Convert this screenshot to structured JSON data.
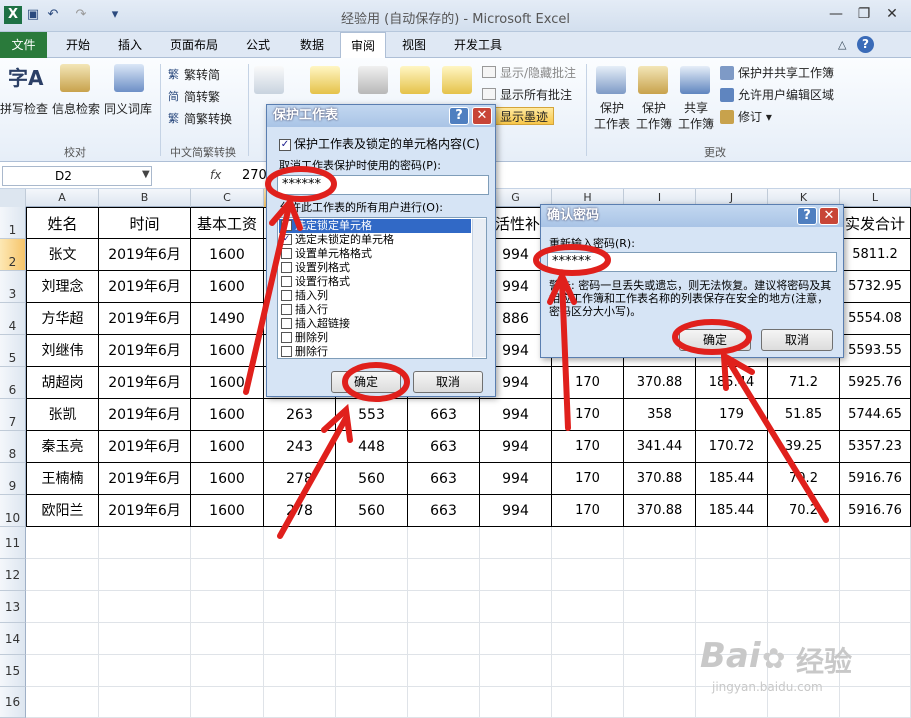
{
  "window": {
    "title": "经验用 (自动保存的)  -  Microsoft Excel",
    "close": "✕",
    "minimize": "—",
    "restore": "❐"
  },
  "ribbon_tabs": [
    "文件",
    "开始",
    "插入",
    "页面布局",
    "公式",
    "数据",
    "审阅",
    "视图",
    "开发工具"
  ],
  "ribbon": {
    "proof": {
      "spell": "拼写检查",
      "research": "信息检索",
      "thesaurus": "同义词库",
      "group": "校对"
    },
    "chinese": {
      "t2s": "繁转简",
      "s2t": "简转繁",
      "convert": "简繁转换",
      "group": "中文简繁转换"
    },
    "comments": {
      "show_hide": "显示/隐藏批注",
      "show_all": "显示所有批注",
      "show_ink": "显示墨迹"
    },
    "changes": {
      "protect_sheet": "保护\n工作表",
      "protect_book": "保护\n工作簿",
      "share_book": "共享\n工作簿",
      "protect_share": "保护并共享工作簿",
      "allow_edit": "允许用户编辑区域",
      "track": "修订 ▾",
      "group": "更改"
    }
  },
  "formula_bar": {
    "name_box": "D2",
    "fx": "fx",
    "value": "270"
  },
  "columns": [
    "A",
    "B",
    "C",
    "D",
    "E",
    "F",
    "G",
    "H",
    "I",
    "J",
    "K",
    "L"
  ],
  "rows": [
    "1",
    "2",
    "3",
    "4",
    "5",
    "6",
    "7",
    "8",
    "9",
    "10",
    "11",
    "12",
    "13",
    "14",
    "15",
    "16"
  ],
  "table": {
    "headers": [
      "姓名",
      "时间",
      "基本工资",
      "",
      "",
      "",
      "生活性补贴",
      "",
      "",
      "",
      "",
      "实发合计"
    ],
    "rows": [
      [
        "张文",
        "2019年6月",
        "1600",
        "",
        "",
        "",
        "994",
        "",
        "",
        "",
        "",
        "5811.2"
      ],
      [
        "刘理念",
        "2019年6月",
        "1600",
        "",
        "",
        "",
        "994",
        "",
        "",
        "",
        "",
        "5732.95"
      ],
      [
        "方华超",
        "2019年6月",
        "1490",
        "",
        "",
        "",
        "886",
        "",
        "",
        "",
        "",
        "5554.08"
      ],
      [
        "刘继伟",
        "2019年6月",
        "1600",
        "",
        "",
        "",
        "994",
        "",
        "",
        "",
        "",
        "5593.55"
      ],
      [
        "胡超岗",
        "2019年6月",
        "1600",
        "",
        "",
        "",
        "994",
        "170",
        "370.88",
        "185.44",
        "71.2",
        "5925.76"
      ],
      [
        "张凯",
        "2019年6月",
        "1600",
        "263",
        "553",
        "663",
        "994",
        "170",
        "358",
        "179",
        "51.85",
        "5744.65"
      ],
      [
        "秦玉亮",
        "2019年6月",
        "1600",
        "243",
        "448",
        "663",
        "994",
        "170",
        "341.44",
        "170.72",
        "39.25",
        "5357.23"
      ],
      [
        "王楠楠",
        "2019年6月",
        "1600",
        "278",
        "560",
        "663",
        "994",
        "170",
        "370.88",
        "185.44",
        "70.2",
        "5916.76"
      ],
      [
        "欧阳兰",
        "2019年6月",
        "1600",
        "278",
        "560",
        "663",
        "994",
        "170",
        "370.88",
        "185.44",
        "70.2",
        "5916.76"
      ]
    ]
  },
  "protect_dialog": {
    "title": "保护工作表",
    "protect_check": "保护工作表及锁定的单元格内容(C)",
    "password_label": "取消工作表保护时使用的密码(P):",
    "password": "******",
    "allow_label": "允许此工作表的所有用户进行(O):",
    "options": [
      {
        "label": "选定锁定单元格",
        "checked": true
      },
      {
        "label": "选定未锁定的单元格",
        "checked": true
      },
      {
        "label": "设置单元格格式",
        "checked": false
      },
      {
        "label": "设置列格式",
        "checked": false
      },
      {
        "label": "设置行格式",
        "checked": false
      },
      {
        "label": "插入列",
        "checked": false
      },
      {
        "label": "插入行",
        "checked": false
      },
      {
        "label": "插入超链接",
        "checked": false
      },
      {
        "label": "删除列",
        "checked": false
      },
      {
        "label": "删除行",
        "checked": false
      }
    ],
    "ok": "确定",
    "cancel": "取消"
  },
  "confirm_dialog": {
    "title": "确认密码",
    "reenter_label": "重新输入密码(R):",
    "password": "******",
    "warning": "警告: 密码一旦丢失或遗忘，则无法恢复。建议将密码及其相应工作簿和工作表名称的列表保存在安全的地方(注意，密码区分大小写)。",
    "ok": "确定",
    "cancel": "取消"
  },
  "watermark": {
    "brand": "Bai",
    "mid": "经验",
    "url": "jingyan.baidu.com"
  },
  "colors": {
    "accent": "#2a7a3b",
    "annotation": "#e0201c"
  }
}
